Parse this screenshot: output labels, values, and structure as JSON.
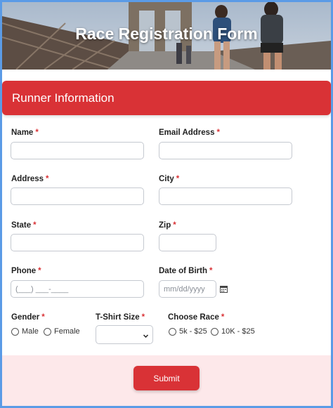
{
  "hero": {
    "title": "Race Registration Form"
  },
  "section": {
    "title": "Runner Information"
  },
  "fields": {
    "name": {
      "label": "Name",
      "required": "*",
      "value": ""
    },
    "email": {
      "label": "Email Address",
      "required": "*",
      "value": ""
    },
    "address": {
      "label": "Address",
      "required": "*",
      "value": ""
    },
    "city": {
      "label": "City",
      "required": "*",
      "value": ""
    },
    "state": {
      "label": "State",
      "required": "*",
      "value": ""
    },
    "zip": {
      "label": "Zip",
      "required": "*",
      "value": ""
    },
    "phone": {
      "label": "Phone",
      "required": "*",
      "placeholder": "(___) ___-____"
    },
    "dob": {
      "label": "Date of Birth",
      "required": "*",
      "placeholder": "mm/dd/yyyy"
    },
    "gender": {
      "label": "Gender",
      "required": "*",
      "options": [
        "Male",
        "Female"
      ]
    },
    "tshirt": {
      "label": "T-Shirt Size",
      "required": "*",
      "selected": ""
    },
    "race": {
      "label": "Choose Race",
      "required": "*",
      "options": [
        "5k - $25",
        "10K - $25"
      ]
    }
  },
  "submit": {
    "label": "Submit"
  },
  "colors": {
    "accent": "#d93236",
    "footer_bg": "#fde8ea",
    "border": "#5b9be6"
  },
  "icons": {
    "calendar": "calendar-icon",
    "chevron": "chevron-down-icon"
  }
}
